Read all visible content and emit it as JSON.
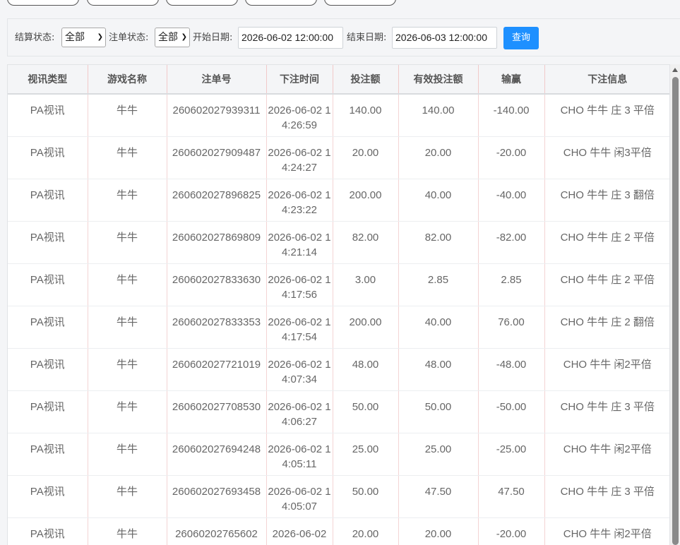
{
  "filters": {
    "settle_status_label": "结算状态:",
    "settle_status_value": "全部",
    "bet_status_label": "注单状态:",
    "bet_status_value": "全部",
    "start_date_label": "开始日期:",
    "start_date_value": "2026-06-02 12:00:00",
    "end_date_label": "结束日期:",
    "end_date_value": "2026-06-03 12:00:00",
    "query_label": "查询"
  },
  "table": {
    "headers": [
      "视讯类型",
      "游戏名称",
      "注单号",
      "下注时间",
      "投注额",
      "有效投注额",
      "输赢",
      "下注信息"
    ],
    "rows": [
      [
        "PA视讯",
        "牛牛",
        "260602027939311",
        "2026-06-02 14:26:59",
        "140.00",
        "140.00",
        "-140.00",
        "CHO 牛牛 庄 3 平倍"
      ],
      [
        "PA视讯",
        "牛牛",
        "260602027909487",
        "2026-06-02 14:24:27",
        "20.00",
        "20.00",
        "-20.00",
        "CHO 牛牛 闲3平倍"
      ],
      [
        "PA视讯",
        "牛牛",
        "260602027896825",
        "2026-06-02 14:23:22",
        "200.00",
        "40.00",
        "-40.00",
        "CHO 牛牛 庄 3 翻倍"
      ],
      [
        "PA视讯",
        "牛牛",
        "260602027869809",
        "2026-06-02 14:21:14",
        "82.00",
        "82.00",
        "-82.00",
        "CHO 牛牛 庄 2 平倍"
      ],
      [
        "PA视讯",
        "牛牛",
        "260602027833630",
        "2026-06-02 14:17:56",
        "3.00",
        "2.85",
        "2.85",
        "CHO 牛牛 庄 2 平倍"
      ],
      [
        "PA视讯",
        "牛牛",
        "260602027833353",
        "2026-06-02 14:17:54",
        "200.00",
        "40.00",
        "76.00",
        "CHO 牛牛 庄 2 翻倍"
      ],
      [
        "PA视讯",
        "牛牛",
        "260602027721019",
        "2026-06-02 14:07:34",
        "48.00",
        "48.00",
        "-48.00",
        "CHO 牛牛 闲2平倍"
      ],
      [
        "PA视讯",
        "牛牛",
        "260602027708530",
        "2026-06-02 14:06:27",
        "50.00",
        "50.00",
        "-50.00",
        "CHO 牛牛 庄 3 平倍"
      ],
      [
        "PA视讯",
        "牛牛",
        "260602027694248",
        "2026-06-02 14:05:11",
        "25.00",
        "25.00",
        "-25.00",
        "CHO 牛牛 闲2平倍"
      ],
      [
        "PA视讯",
        "牛牛",
        "260602027693458",
        "2026-06-02 14:05:07",
        "50.00",
        "47.50",
        "47.50",
        "CHO 牛牛 庄 3 平倍"
      ],
      [
        "PA视讯",
        "牛牛",
        "26060202765602",
        "2026-06-02",
        "20.00",
        "20.00",
        "-20.00",
        "CHO 牛牛 闲2平倍"
      ]
    ]
  }
}
